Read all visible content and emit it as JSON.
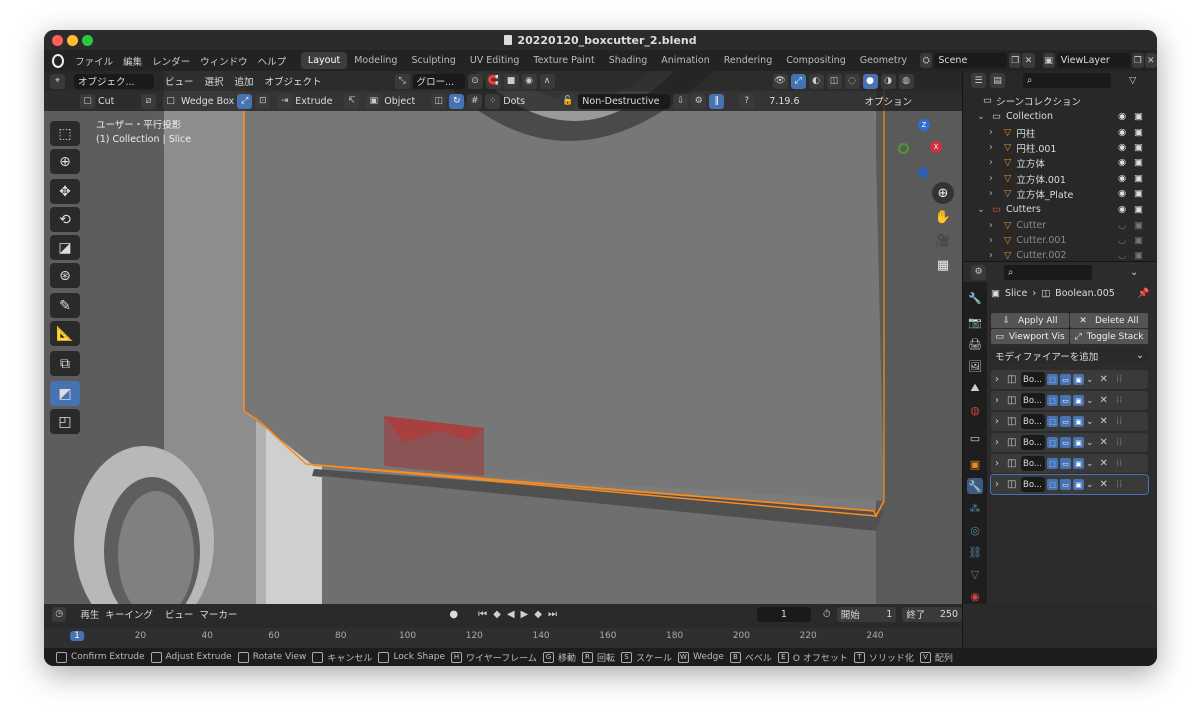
{
  "window": {
    "title": "20220120_boxcutter_2.blend"
  },
  "menu": {
    "items": [
      "ファイル",
      "編集",
      "レンダー",
      "ウィンドウ",
      "ヘルプ"
    ],
    "workspaces": [
      "Layout",
      "Modeling",
      "Sculpting",
      "UV Editing",
      "Texture Paint",
      "Shading",
      "Animation",
      "Rendering",
      "Compositing",
      "Geometry"
    ],
    "active_workspace": "Layout",
    "scene": "Scene",
    "view_layer": "ViewLayer"
  },
  "viewport_header": {
    "mode": "オブジェク...",
    "view": "ビュー",
    "select": "選択",
    "add": "追加",
    "object": "オブジェクト",
    "orientation": "グロー..."
  },
  "tool_header": {
    "cut": "Cut",
    "shape": "Wedge Box",
    "extrude": "Extrude",
    "object": "Object",
    "dots": "Dots",
    "nondestructive": "Non-Destructive",
    "version": "7.19.6",
    "options": "オプション"
  },
  "viewport": {
    "projection": "ユーザー・平行投影",
    "context": "(1) Collection | Slice"
  },
  "outliner": {
    "root": "シーンコレクション",
    "rows": [
      {
        "label": "Collection",
        "type": "collection"
      },
      {
        "label": "円柱",
        "type": "mesh"
      },
      {
        "label": "円柱.001",
        "type": "mesh"
      },
      {
        "label": "立方体",
        "type": "mesh"
      },
      {
        "label": "立方体.001",
        "type": "mesh"
      },
      {
        "label": "立方体_Plate",
        "type": "mesh"
      },
      {
        "label": "Cutters",
        "type": "collection"
      },
      {
        "label": "Cutter",
        "type": "mesh"
      },
      {
        "label": "Cutter.001",
        "type": "mesh"
      },
      {
        "label": "Cutter.002",
        "type": "mesh"
      }
    ]
  },
  "properties": {
    "breadcrumb_object": "Slice",
    "breadcrumb_modifier": "Boolean.005",
    "apply_all": "Apply All",
    "delete_all": "Delete All",
    "viewport_vis": "Viewport Vis",
    "toggle_stack": "Toggle Stack",
    "add_modifier": "モディファイアーを追加",
    "modifier_label": "Bo...",
    "modifier_count": 6
  },
  "timeline": {
    "playback": "再生",
    "keying": "キーイング",
    "view": "ビュー",
    "marker": "マーカー",
    "current_frame": "1",
    "start_label": "開始",
    "start": "1",
    "end_label": "終了",
    "end": "250",
    "ticks": [
      "1",
      "20",
      "40",
      "60",
      "80",
      "100",
      "120",
      "140",
      "160",
      "180",
      "200",
      "220",
      "240"
    ]
  },
  "status": {
    "items": [
      {
        "key": "",
        "label": "Confirm Extrude"
      },
      {
        "key": "",
        "label": "Adjust Extrude"
      },
      {
        "key": "",
        "label": "Rotate View"
      },
      {
        "key": "",
        "label": "キャンセル"
      },
      {
        "key": "",
        "label": "Lock Shape"
      },
      {
        "key": "H",
        "label": "ワイヤーフレーム"
      },
      {
        "key": "G",
        "label": "移動"
      },
      {
        "key": "R",
        "label": "回転"
      },
      {
        "key": "S",
        "label": "スケール"
      },
      {
        "key": "W",
        "label": "Wedge"
      },
      {
        "key": "B",
        "label": "ベベル"
      },
      {
        "key": "E",
        "label": "O オフセット"
      },
      {
        "key": "T",
        "label": "ソリッド化"
      },
      {
        "key": "V",
        "label": "配列"
      }
    ]
  }
}
